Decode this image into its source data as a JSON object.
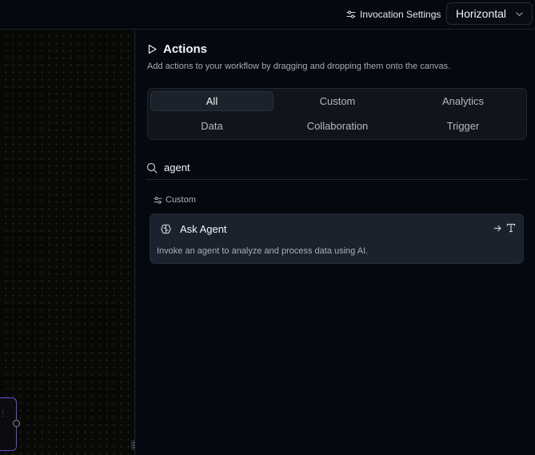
{
  "topbar": {
    "invocation_settings_label": "Invocation Settings",
    "layout_select_value": "Horizontal"
  },
  "panel": {
    "title": "Actions",
    "description": "Add actions to your workflow by dragging and dropping them onto the canvas.",
    "tabs": [
      {
        "label": "All",
        "active": true
      },
      {
        "label": "Custom",
        "active": false
      },
      {
        "label": "Analytics",
        "active": false
      },
      {
        "label": "Data",
        "active": false
      },
      {
        "label": "Collaboration",
        "active": false
      },
      {
        "label": "Trigger",
        "active": false
      }
    ],
    "search": {
      "value": "agent",
      "icon": "search-icon"
    },
    "groups": [
      {
        "label": "Custom",
        "icon": "sliders-icon",
        "items": [
          {
            "title": "Ask Agent",
            "description": "Invoke an agent to analyze and process data using AI.",
            "icon": "brain-icon"
          }
        ]
      }
    ]
  },
  "colors": {
    "background": "#05080f",
    "card": "#1b222d",
    "node_border": "#6d4ad8"
  }
}
